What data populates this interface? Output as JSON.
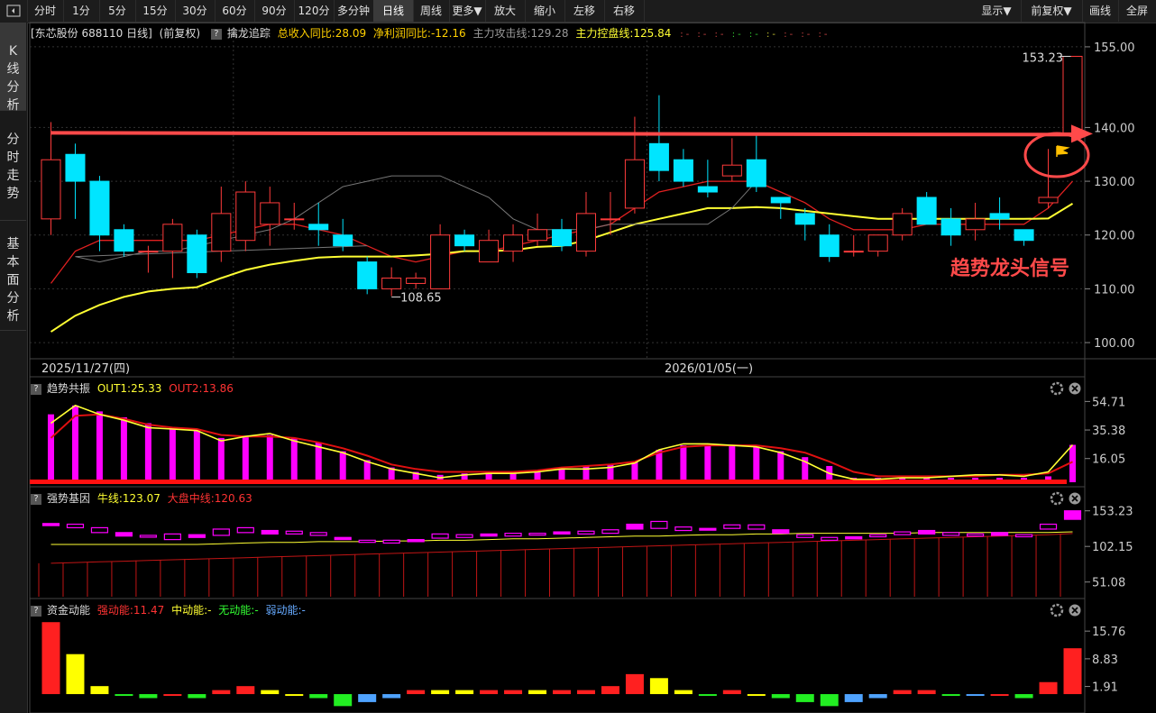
{
  "toolbar": {
    "buttons": [
      "分时",
      "1分",
      "5分",
      "15分",
      "30分",
      "60分",
      "90分",
      "120分",
      "多分钟",
      "日线",
      "周线",
      "更多▼",
      "放大",
      "缩小",
      "左移",
      "右移"
    ],
    "active": "日线",
    "right_buttons": [
      "显示▼",
      "前复权▼",
      "画线",
      "全屏"
    ]
  },
  "sidebar": {
    "tabs": [
      "K线分析",
      "分时走势",
      "基本面分析"
    ]
  },
  "main": {
    "stock_label": "[东芯股份 688110 日线]",
    "adjust": "(前复权)",
    "indicator_name": "擒龙追踪",
    "revenue_growth": "总收入同比:28.09",
    "profit_growth": "净利润同比:-12.16",
    "attack_line": "主力攻击线:129.28",
    "control_line": "主力控盘线:125.84",
    "high_label": "153.23",
    "low_label": "108.65",
    "annotation": "趋势龙头信号",
    "date_left": "2025/11/27(四)",
    "date_mid": "2026/01/05(一)"
  },
  "panel2": {
    "name": "趋势共振",
    "out1": "OUT1:25.33",
    "out2": "OUT2:13.86"
  },
  "panel3": {
    "name": "强势基因",
    "bull": "牛线:123.07",
    "market": "大盘中线:120.63"
  },
  "panel4": {
    "name": "资金动能",
    "strong": "强动能:11.47",
    "mid": "中动能:-",
    "none": "无动能:-",
    "weak": "弱动能:-"
  },
  "colors": {
    "up": "#ff3b3b",
    "down": "#00e5ff",
    "ma_yellow": "#ffff33",
    "ma_red": "#e02020",
    "magenta": "#ff00ff"
  },
  "chart_data": [
    {
      "type": "candlestick",
      "title": "东芯股份 688110 日线",
      "ylim": [
        98,
        157
      ],
      "yticks": [
        100.0,
        110.0,
        120.0,
        130.0,
        140.0,
        155.0
      ],
      "candles": [
        [
          123,
          134,
          141,
          120
        ],
        [
          135,
          130,
          137,
          123
        ],
        [
          130,
          120,
          131,
          117
        ],
        [
          121,
          117,
          122,
          116
        ],
        [
          117,
          117,
          118,
          113
        ],
        [
          117,
          122,
          123,
          112
        ],
        [
          120,
          113,
          121,
          112
        ],
        [
          117,
          124,
          129,
          115
        ],
        [
          119,
          128,
          130,
          117
        ],
        [
          122,
          126,
          129,
          118
        ],
        [
          123,
          123,
          126,
          121
        ],
        [
          122,
          121,
          126,
          118
        ],
        [
          120,
          118,
          123,
          117
        ],
        [
          115,
          110,
          116,
          109
        ],
        [
          110,
          112,
          114,
          108.65
        ],
        [
          111,
          112,
          113,
          110
        ],
        [
          110,
          120,
          122,
          110
        ],
        [
          120,
          118,
          121,
          117
        ],
        [
          115,
          119,
          121,
          115
        ],
        [
          117,
          120,
          122,
          115
        ],
        [
          119,
          121,
          124,
          118
        ],
        [
          121,
          118,
          123,
          117
        ],
        [
          117,
          124,
          128,
          116
        ],
        [
          123,
          123,
          128,
          120
        ],
        [
          125,
          134,
          142,
          124
        ],
        [
          137,
          132,
          146,
          130
        ],
        [
          134,
          130,
          136,
          129
        ],
        [
          129,
          128,
          134,
          127
        ],
        [
          131,
          133,
          138,
          130
        ],
        [
          134,
          129,
          139,
          128
        ],
        [
          127,
          126,
          127,
          123
        ],
        [
          124,
          122,
          125,
          119
        ],
        [
          120,
          116,
          122,
          115
        ],
        [
          117,
          117,
          120,
          116
        ],
        [
          117,
          120,
          120,
          116
        ],
        [
          120,
          124,
          125,
          119
        ],
        [
          127,
          122,
          128,
          122
        ],
        [
          123,
          120,
          125,
          118
        ],
        [
          121,
          123,
          126,
          119
        ],
        [
          124,
          123,
          127,
          121
        ],
        [
          121,
          119,
          121,
          118
        ],
        [
          126,
          127,
          136,
          125
        ],
        [
          139,
          153.23,
          153.23,
          138
        ]
      ],
      "ma_red": [
        111,
        117,
        119,
        119,
        119,
        119,
        119,
        120,
        121,
        122,
        122,
        121,
        120,
        118,
        116,
        115,
        116,
        117,
        117,
        118,
        119,
        120,
        121,
        122,
        125,
        128,
        129,
        130,
        130,
        130,
        128,
        126,
        123,
        121,
        121,
        121,
        122,
        122,
        122,
        122,
        122,
        125,
        130
      ],
      "ma_yellow": [
        102,
        105,
        107,
        108.5,
        109.5,
        110,
        110.3,
        112,
        113.5,
        114.5,
        115.2,
        115.8,
        116,
        116,
        116,
        116.2,
        116.5,
        117,
        117,
        117.2,
        117.8,
        118,
        119,
        120.5,
        122,
        123,
        124,
        125,
        125,
        125.2,
        125,
        124.5,
        124,
        123.5,
        123,
        123,
        123,
        123,
        123,
        123,
        123,
        123.07,
        125.84
      ]
    },
    {
      "type": "bar",
      "title": "趋势共振",
      "yticks": [
        16.05,
        35.38,
        54.71
      ],
      "values": [
        46,
        52,
        48,
        44,
        40,
        37,
        36,
        30,
        31,
        32,
        30,
        27,
        21,
        15,
        10,
        7,
        5,
        6,
        7,
        7,
        8,
        10,
        11,
        12,
        14,
        22,
        25,
        25,
        25,
        24,
        21,
        17,
        11,
        3,
        3,
        3,
        3,
        3,
        3,
        3,
        3,
        4,
        25.33
      ],
      "line1": [
        40,
        52,
        46,
        42,
        37,
        36,
        35,
        28,
        31,
        33,
        28,
        24,
        20,
        14,
        9,
        6,
        3,
        5,
        6,
        6,
        7,
        9,
        9,
        10,
        13,
        22,
        26,
        26,
        25,
        24,
        20,
        14,
        6,
        2,
        2,
        3,
        3,
        4,
        5,
        5,
        4,
        7,
        25.33
      ],
      "line2": [
        30,
        45,
        46,
        43,
        39,
        37,
        36,
        32,
        31,
        31,
        30,
        27,
        23,
        18,
        12,
        9,
        7,
        7,
        7,
        7,
        8,
        10,
        11,
        12,
        14,
        20,
        24,
        25,
        25,
        25,
        23,
        20,
        14,
        7,
        4,
        4,
        4,
        4,
        4,
        5,
        5,
        6,
        13.86
      ]
    },
    {
      "type": "bar",
      "title": "强势基因",
      "yticks": [
        51.08,
        102.15,
        153.23
      ],
      "boxes": [
        [
          132,
          135
        ],
        [
          129,
          134
        ],
        [
          122,
          129
        ],
        [
          117,
          122
        ],
        [
          116,
          118
        ],
        [
          112,
          120
        ],
        [
          115,
          119
        ],
        [
          118,
          127
        ],
        [
          122,
          129
        ],
        [
          120,
          125
        ],
        [
          120,
          124
        ],
        [
          118,
          122
        ],
        [
          112,
          115
        ],
        [
          108,
          111
        ],
        [
          107,
          111
        ],
        [
          109,
          112
        ],
        [
          114,
          120
        ],
        [
          115,
          119
        ],
        [
          117,
          120
        ],
        [
          117,
          121
        ],
        [
          119,
          121
        ],
        [
          120,
          123
        ],
        [
          120,
          124
        ],
        [
          121,
          126
        ],
        [
          127,
          134
        ],
        [
          128,
          138
        ],
        [
          125,
          130
        ],
        [
          126,
          128
        ],
        [
          128,
          133
        ],
        [
          127,
          133
        ],
        [
          121,
          126
        ],
        [
          115,
          119
        ],
        [
          111,
          115
        ],
        [
          113,
          116
        ],
        [
          116,
          119
        ],
        [
          119,
          123
        ],
        [
          120,
          125
        ],
        [
          118,
          122
        ],
        [
          117,
          120
        ],
        [
          118,
          122
        ],
        [
          116,
          119
        ],
        [
          127,
          134
        ],
        [
          141,
          153.23
        ]
      ],
      "bull": [
        105,
        105,
        105,
        105,
        105,
        105,
        105,
        106,
        107,
        108,
        108,
        109,
        109,
        109,
        110,
        110,
        111,
        111,
        112,
        113,
        113,
        114,
        115,
        116,
        117,
        117,
        118,
        119,
        119,
        120,
        120,
        121,
        121,
        121,
        121,
        121,
        122,
        122,
        122,
        122,
        122,
        122,
        123.07
      ],
      "market": [
        78,
        79,
        80,
        81,
        82,
        83,
        84,
        85,
        86,
        87,
        88,
        89,
        90,
        91,
        92,
        93,
        94,
        95,
        96,
        97,
        98,
        99,
        100,
        101,
        102,
        103,
        104,
        105,
        106,
        107,
        108,
        109,
        110,
        111,
        112,
        113,
        114,
        115,
        116,
        117,
        118,
        119,
        120.63
      ]
    },
    {
      "type": "bar",
      "title": "资金动能",
      "yticks": [
        1.91,
        8.83,
        15.76
      ],
      "values": [
        18,
        10,
        2,
        0,
        -1,
        0,
        -1,
        1,
        2,
        1,
        0,
        -1,
        -3,
        -2,
        -1,
        1,
        1,
        1,
        1,
        1,
        1,
        1,
        1,
        2,
        5,
        4,
        1,
        0,
        1,
        0,
        -1,
        -2,
        -3,
        -2,
        -1,
        1,
        1,
        0,
        0,
        0,
        -1,
        3,
        11.47
      ],
      "types": [
        "r",
        "y",
        "y",
        "g",
        "g",
        "r",
        "g",
        "r",
        "r",
        "y",
        "y",
        "g",
        "g",
        "b",
        "b",
        "r",
        "y",
        "y",
        "r",
        "r",
        "y",
        "r",
        "r",
        "r",
        "r",
        "y",
        "y",
        "g",
        "r",
        "y",
        "g",
        "g",
        "g",
        "b",
        "b",
        "r",
        "r",
        "g",
        "b",
        "r",
        "g",
        "r",
        "r"
      ]
    }
  ]
}
